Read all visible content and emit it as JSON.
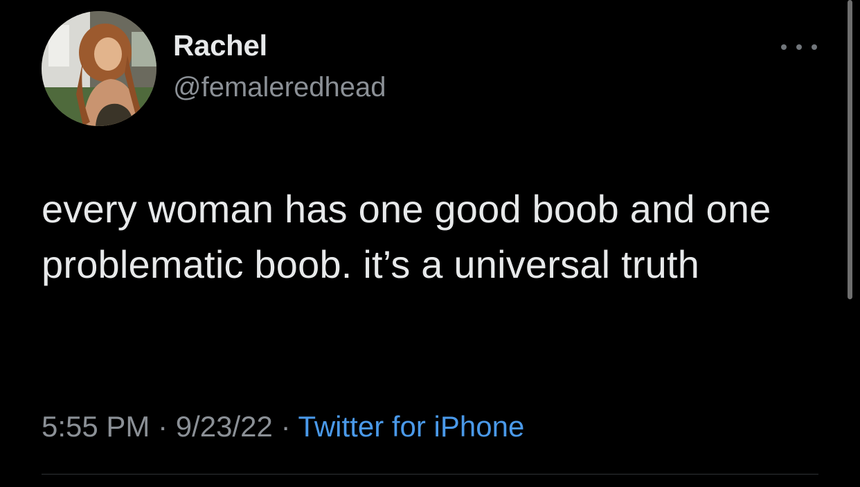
{
  "user": {
    "display_name": "Rachel",
    "handle": "@femaleredhead"
  },
  "tweet": {
    "text": "every woman has one good boob and one problematic boob. it’s a universal truth",
    "time": "5:55 PM",
    "date": "9/23/22",
    "separator": "·",
    "source": "Twitter for iPhone"
  },
  "icons": {
    "more": "more-horizontal-icon",
    "avatar": "profile-photo"
  },
  "colors": {
    "background": "#000000",
    "text": "#e7e9ea",
    "secondary": "#8b9096",
    "link": "#4a99e9"
  }
}
